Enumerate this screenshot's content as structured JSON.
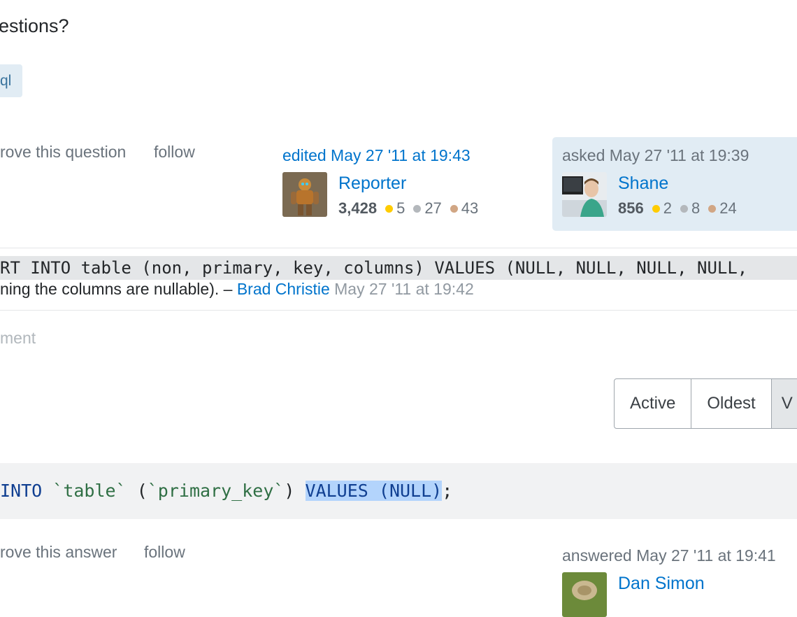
{
  "question": {
    "title": "estions?",
    "tag": "ql",
    "actions": {
      "improve": "rove this question",
      "follow": "follow"
    },
    "edited": {
      "label": "edited May 27 '11 at 19:43",
      "user": "Reporter",
      "reputation": "3,428",
      "gold": "5",
      "silver": "27",
      "bronze": "43"
    },
    "asked": {
      "label": "asked May 27 '11 at 19:39",
      "user": "Shane",
      "reputation": "856",
      "gold": "2",
      "silver": "8",
      "bronze": "24"
    }
  },
  "comment": {
    "code": "RT INTO table (non, primary, key, columns) VALUES (NULL, NULL, NULL, NULL,",
    "text": "ning the columns are nullable). –",
    "author": "Brad Christie",
    "time": "May 27 '11 at 19:42",
    "add_comment": "ment"
  },
  "sort": {
    "options": [
      "Active",
      "Oldest",
      "V"
    ]
  },
  "answer": {
    "code": {
      "kw1": "INTO",
      "t1": "`table`",
      "p1": " (",
      "t2": "`primary_key`",
      "p2": ") ",
      "sel": "VALUES (NULL)",
      "end": ";"
    },
    "actions": {
      "improve": "rove this answer",
      "follow": "follow"
    },
    "answered": {
      "label": "answered May 27 '11 at 19:41",
      "user": "Dan Simon"
    }
  },
  "colors": {
    "link": "#0074cc",
    "tag_bg": "#e1ecf4",
    "owner_bg": "#e1ecf4",
    "gold": "#ffcc01",
    "silver": "#b4b8bc",
    "bronze": "#d1a684"
  }
}
